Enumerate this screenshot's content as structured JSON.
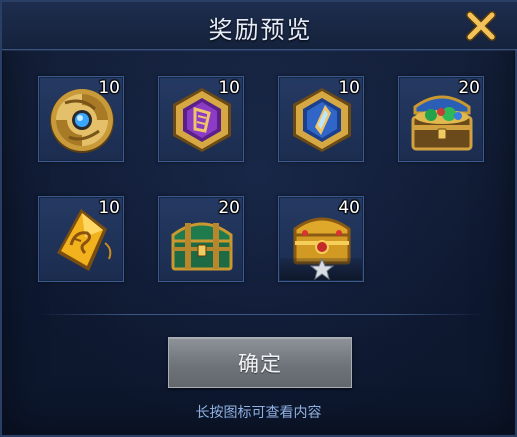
{
  "dialog": {
    "title": "奖励预览",
    "confirm_label": "确定",
    "hint": "长按图标可查看内容"
  },
  "rewards": [
    {
      "icon": "gold-blue-gem-medallion-icon",
      "count": "10"
    },
    {
      "icon": "purple-rune-fragment-icon",
      "count": "10"
    },
    {
      "icon": "blue-rune-fragment-icon",
      "count": "10"
    },
    {
      "icon": "jeweled-treasure-chest-icon",
      "count": "20"
    },
    {
      "icon": "gold-dragon-crystal-icon",
      "count": "10"
    },
    {
      "icon": "green-treasure-chest-icon",
      "count": "20"
    },
    {
      "icon": "gold-treasure-chest-star-icon",
      "count": "40"
    }
  ],
  "colors": {
    "panel": "#142039",
    "slot": "#253a63",
    "gold": "#d7a93c",
    "close": "#e8b44a",
    "button": "#7e838a",
    "hint": "#8fb0e0"
  }
}
